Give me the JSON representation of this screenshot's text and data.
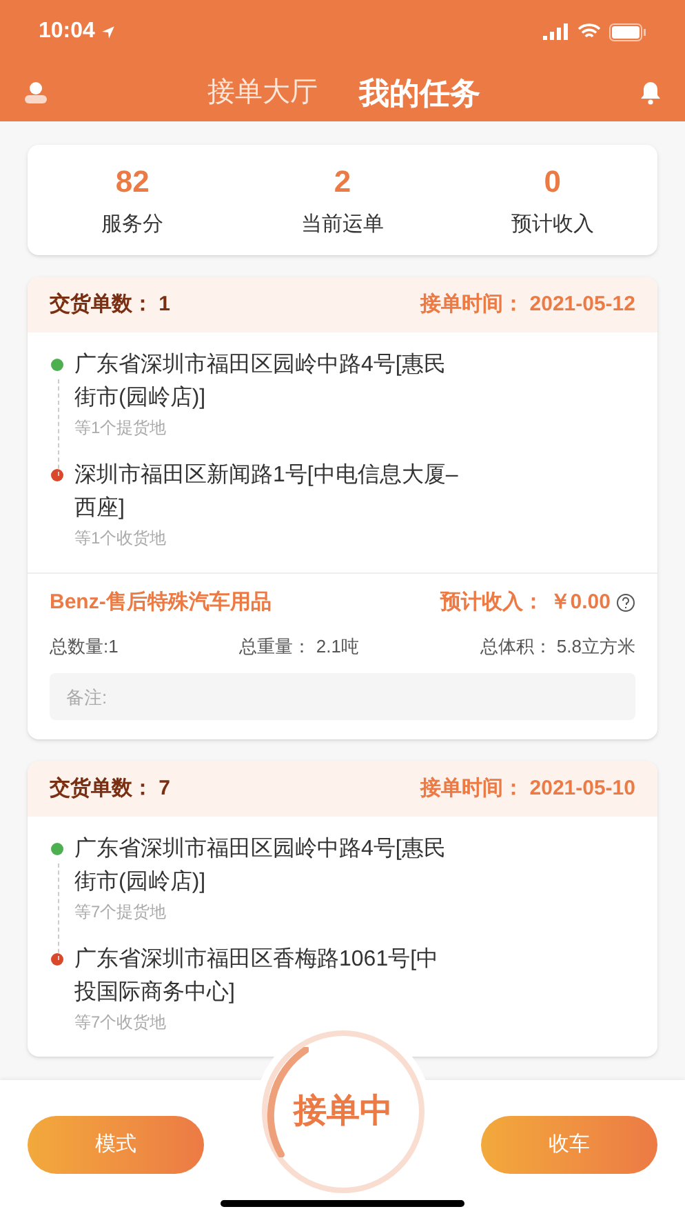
{
  "status_bar": {
    "time": "10:04"
  },
  "tabs": [
    {
      "label": "接单大厅",
      "selected": false
    },
    {
      "label": "我的任务",
      "selected": true
    }
  ],
  "stats": [
    {
      "value": "82",
      "label": "服务分"
    },
    {
      "value": "2",
      "label": "当前运单"
    },
    {
      "value": "0",
      "label": "预计收入"
    }
  ],
  "orders": [
    {
      "count": "交货单数： 1",
      "time": "接单时间： 2021-05-12",
      "pickup": {
        "address": "广东省深圳市福田区园岭中路4号[惠民街市(园岭店)]",
        "note": "等1个提货地"
      },
      "delivery": {
        "address": "深圳市福田区新闻路1号[中电信息大厦–西座]",
        "note": "等1个收货地"
      },
      "details": {
        "name": "Benz-售后特殊汽车用品",
        "income": "预计收入： ￥0.00",
        "quantity": "总数量:1",
        "weight": "总重量： 2.1吨",
        "volume": "总体积： 5.8立方米",
        "remark_placeholder": "备注:"
      }
    },
    {
      "count": "交货单数： 7",
      "time": "接单时间： 2021-05-10",
      "pickup": {
        "address": "广东省深圳市福田区园岭中路4号[惠民街市(园岭店)]",
        "note": "等7个提货地"
      },
      "delivery": {
        "address": "广东省深圳市福田区香梅路1061号[中投国际商务中心]",
        "note": "等7个收货地"
      }
    }
  ],
  "bottom_bar": {
    "left_button": "模式",
    "status": "接单中",
    "right_button": "收车"
  }
}
